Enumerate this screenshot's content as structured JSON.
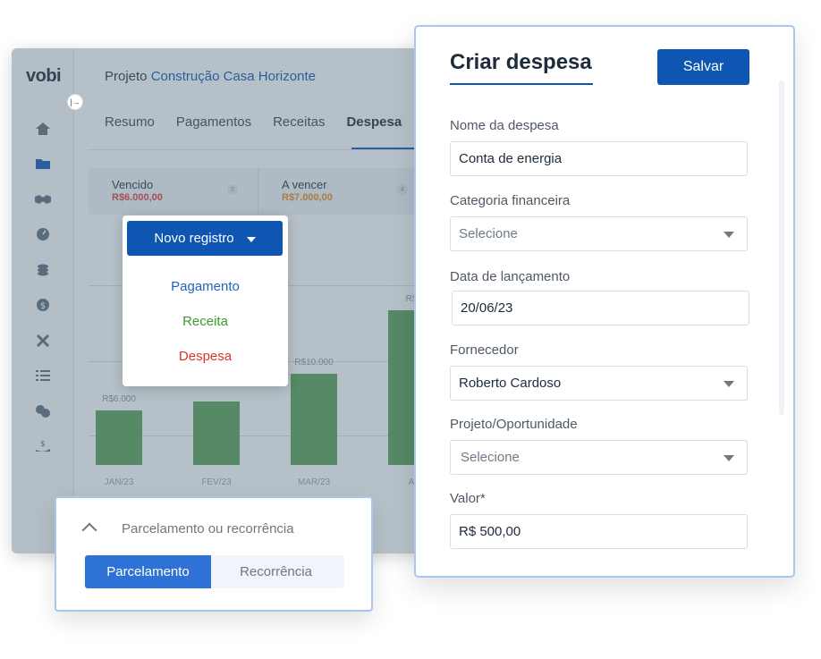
{
  "app": {
    "logo": "vobi",
    "project_prefix": "Projeto",
    "project_name": "Construção Casa Horizonte",
    "tabs": [
      {
        "label": "Resumo"
      },
      {
        "label": "Pagamentos"
      },
      {
        "label": "Receitas"
      },
      {
        "label": "Despesa"
      }
    ],
    "sidebar_icons": [
      "home-icon",
      "folder-icon",
      "handshake-icon",
      "gauge-icon",
      "coins-icon",
      "dollar-icon",
      "tools-icon",
      "list-icon",
      "chat-icon",
      "money-hand-icon"
    ],
    "summary": [
      {
        "label": "Vencido",
        "amount": "R$6.000,00",
        "count": "3",
        "color": "#e0413c"
      },
      {
        "label": "A vencer",
        "amount": "R$7.000,00",
        "count": "4",
        "color": "#e88a1a"
      }
    ]
  },
  "chart_data": {
    "type": "bar",
    "categories": [
      "JAN/23",
      "FEV/23",
      "MAR/23",
      "A"
    ],
    "values": [
      6000,
      7000,
      10000,
      17000
    ],
    "data_labels": [
      "R$6.000",
      "",
      "R$10.000",
      "R$"
    ],
    "colors": {
      "bar": "#5aa055"
    }
  },
  "dropdown": {
    "button_label": "Novo registro",
    "items": [
      {
        "label": "Pagamento",
        "color": "#1e63c0"
      },
      {
        "label": "Receita",
        "color": "#3f9a2c"
      },
      {
        "label": "Despesa",
        "color": "#d9342b"
      }
    ]
  },
  "installment": {
    "title": "Parcelamento ou recorrência",
    "options": [
      {
        "label": "Parcelamento",
        "active": true
      },
      {
        "label": "Recorrência",
        "active": false
      }
    ]
  },
  "form": {
    "title": "Criar despesa",
    "save_label": "Salvar",
    "fields": [
      {
        "label": "Nome da despesa",
        "value": "Conta de energia",
        "type": "text"
      },
      {
        "label": "Categoria financeira",
        "value": "Selecione",
        "type": "select",
        "placeholder": true
      },
      {
        "label": "Data de lançamento",
        "value": "20/06/23",
        "type": "text"
      },
      {
        "label": "Fornecedor",
        "value": "Roberto Cardoso",
        "type": "select"
      },
      {
        "label": "Projeto/Oportunidade",
        "value": "Selecione",
        "type": "select",
        "placeholder": true
      },
      {
        "label": "Valor*",
        "value": "R$ 500,00",
        "type": "text"
      }
    ]
  }
}
